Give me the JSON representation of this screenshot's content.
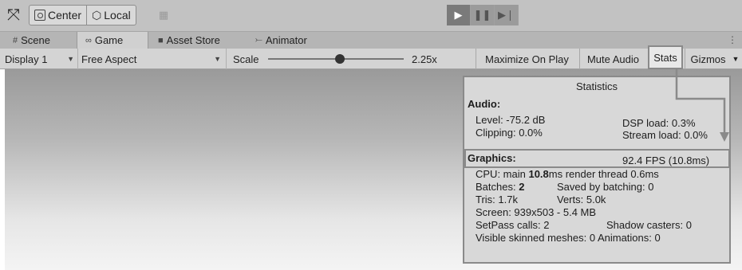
{
  "toolbar": {
    "tool_icon": "transform-tool-icon",
    "pivot_center_label": "Center",
    "pivot_local_label": "Local",
    "snap_icon": "grid-snap-icon",
    "play_icon": "play-icon",
    "pause_icon": "pause-icon",
    "step_icon": "step-icon"
  },
  "tabs": [
    {
      "label": "Scene",
      "icon": "scene-grid-icon"
    },
    {
      "label": "Game",
      "icon": "gamepad-icon"
    },
    {
      "label": "Asset Store",
      "icon": "shopping-bag-icon"
    },
    {
      "label": "Animator",
      "icon": "animator-icon"
    }
  ],
  "gamebar": {
    "display_label": "Display 1",
    "aspect_label": "Free Aspect",
    "scale_label": "Scale",
    "scale_value": "2.25x",
    "maximize_label": "Maximize On Play",
    "mute_label": "Mute Audio",
    "stats_label": "Stats",
    "gizmos_label": "Gizmos"
  },
  "stats": {
    "title": "Statistics",
    "audio_header": "Audio:",
    "level": "Level: -75.2 dB",
    "clipping": "Clipping: 0.0%",
    "dsp_load": "DSP load: 0.3%",
    "stream_load": "Stream load: 0.0%",
    "graphics_header": "Graphics:",
    "fps": "92.4 FPS (10.8ms)",
    "cpu_prefix": "CPU: main ",
    "cpu_main": "10.8",
    "cpu_suffix": "ms  render thread 0.6ms",
    "batches_prefix": "Batches: ",
    "batches_value": "2",
    "saved_batching": "Saved by batching: 0",
    "tris": "Tris: 1.7k",
    "verts": "Verts: 5.0k",
    "screen": "Screen: 939x503 - 5.4 MB",
    "setpass": "SetPass calls: 2",
    "shadow_casters": "Shadow casters: 0",
    "skinned": "Visible skinned meshes: 0  Animations: 0"
  }
}
